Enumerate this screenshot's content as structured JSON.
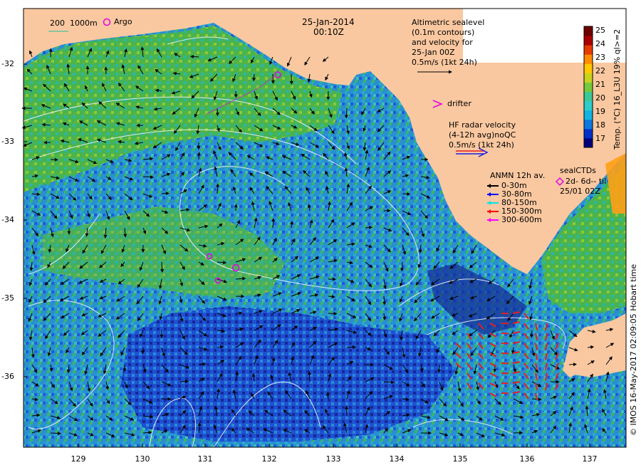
{
  "title": {
    "date": "25-Jan-2014",
    "time": "00:10Z"
  },
  "scale_bar": {
    "labels": [
      "200",
      "1000m"
    ]
  },
  "argo": {
    "label": "Argo"
  },
  "altimetry": {
    "lines": [
      "Altimetric sealevel",
      "(0.1m contours)",
      "and velocity for",
      "25-Jan 00Z",
      "0.5m/s (1kt 24h)"
    ]
  },
  "drifter": {
    "label": "drifter"
  },
  "hf_radar": {
    "lines": [
      "HF radar velocity",
      "(4-12h avg)noQC",
      "0.5m/s (1kt 24h)"
    ]
  },
  "anmn": {
    "title": "ANMN 12h av.",
    "items": [
      {
        "label": "0-30m",
        "color": "#000000"
      },
      {
        "label": "30-80m",
        "color": "#0000ff"
      },
      {
        "label": "80-150m",
        "color": "#00e5e5"
      },
      {
        "label": "150-300m",
        "color": "#ff0000"
      },
      {
        "label": "300-600m",
        "color": "#ff00ff"
      }
    ]
  },
  "seal_ctds": {
    "lines": [
      "sealCTDs",
      "2d- 6d-- til",
      "25/01 02Z"
    ]
  },
  "colorbar": {
    "ticks": [
      "25",
      "24",
      "23",
      "22",
      "21",
      "20",
      "19",
      "18",
      "17"
    ],
    "label": "Temp. (°C) 16_L3U 19% ql>=2",
    "colors": [
      "#00007a",
      "#0030c8",
      "#0a78e0",
      "#12b4e0",
      "#30cccc",
      "#3cc896",
      "#78c83c",
      "#c8d21e",
      "#ffc800",
      "#ff8c00",
      "#e63c00",
      "#aa0000",
      "#6e0000"
    ]
  },
  "y_axis": {
    "ticks": [
      "-32",
      "-33",
      "-34",
      "-35",
      "-36"
    ]
  },
  "x_axis": {
    "ticks": [
      "129",
      "130",
      "131",
      "132",
      "133",
      "134",
      "135",
      "136",
      "137"
    ]
  },
  "credit": "© IMOS 16-May-2017 02:09:05 Hobart time",
  "colors": {
    "land": "#fac8a0",
    "sea_blue": "#1e5adc",
    "sea_green": "#3cb464",
    "sea_teal": "#28aac8",
    "contour": "#f0f0ff",
    "radar_arrow": "#e61e1e"
  }
}
